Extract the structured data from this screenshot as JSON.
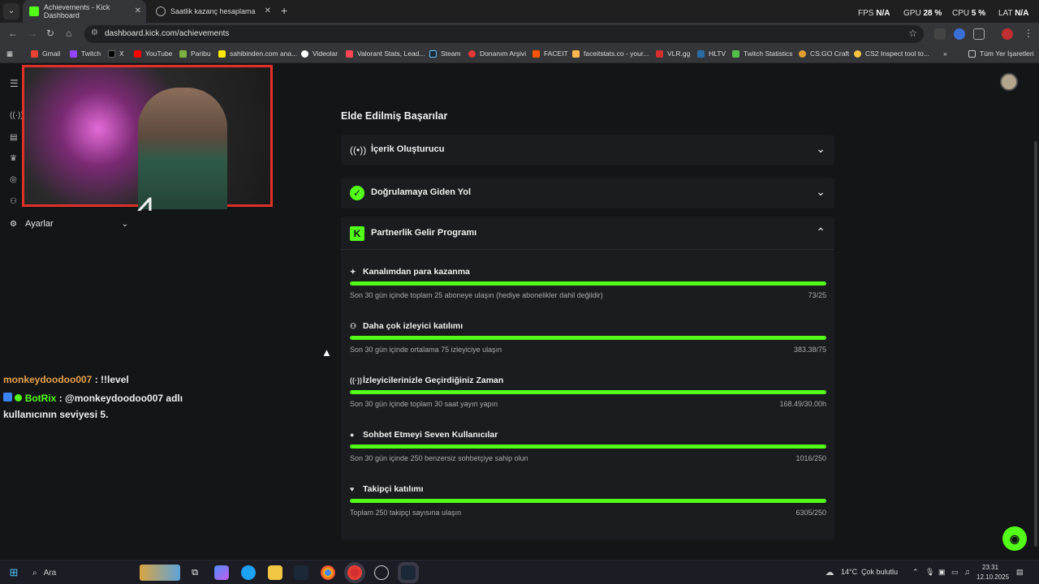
{
  "browser": {
    "tabs": [
      {
        "title": "Achievements - Kick Dashboard",
        "active": true
      },
      {
        "title": "Saatlik kazanç hesaplama",
        "active": false
      }
    ],
    "hw": {
      "fps_label": "FPS",
      "fps": "N/A",
      "gpu_label": "GPU",
      "gpu": "28 %",
      "cpu_label": "CPU",
      "cpu": "5 %",
      "lat_label": "LAT",
      "lat": "N/A"
    },
    "url": "dashboard.kick.com/achievements",
    "bookmarks": [
      "Gmail",
      "Twitch",
      "X",
      "YouTube",
      "Paribu",
      "sahibinden.com ana...",
      "Videolar",
      "Valorant Stats, Lead...",
      "Steam",
      "Donanım Arşivi",
      "FACEIT",
      "faceitstats.co - your...",
      "VLR.gg",
      "HLTV",
      "Twitch Statistics",
      "CS:GO Craft",
      "CS2 Inspect tool to..."
    ],
    "all_bookmarks": "Tüm Yer İşaretleri"
  },
  "sidebar": {
    "settings_label": "Ayarlar"
  },
  "chat": [
    {
      "user": "monkeydoodoo007",
      "text": " : !!level"
    },
    {
      "user": "BotRix",
      "text": " : @monkeydoodoo007 adlı",
      "text2": "kullanıcının seviyesi 5."
    }
  ],
  "main": {
    "title": "Elde Edilmiş Başarılar",
    "sections": [
      {
        "label": "İçerik Oluşturucu",
        "expanded": false
      },
      {
        "label": "Doğrulamaya Giden Yol",
        "expanded": false
      },
      {
        "label": "Partnerlik Gelir Programı",
        "expanded": true
      }
    ],
    "achievements": [
      {
        "title": "Kanalımdan para kazanma",
        "desc": "Son 30 gün içinde toplam 25 aboneye ulaşın (hediye abonelikler dahil değildir)",
        "value": "73/25",
        "progress": 1.0
      },
      {
        "title": "Daha çok izleyici katılımı",
        "desc": "Son 30 gün içinde ortalama 75 izleyiciye ulaşın",
        "value": "383.38/75",
        "progress": 1.0
      },
      {
        "title": "İzleyicilerinizle Geçirdiğiniz Zaman",
        "desc": "Son 30 gün içinde toplam 30 saat yayın yapın",
        "value": "168.49/30.00h",
        "progress": 1.0
      },
      {
        "title": "Sohbet Etmeyi Seven Kullanıcılar",
        "desc": "Son 30 gün içinde 250 benzersiz sohbetçiye sahip olun",
        "value": "1016/250",
        "progress": 1.0
      },
      {
        "title": "Takipçi katılımı",
        "desc": "Toplam 250 takipçi sayısına ulaşın",
        "value": "6305/250",
        "progress": 1.0
      }
    ]
  },
  "taskbar": {
    "search": "Ara",
    "weather": "14°C",
    "weather_desc": "Çok bulutlu",
    "time": "23:31",
    "date": "12.10.2025"
  },
  "colors": {
    "accent": "#53fc18",
    "background": "#141517",
    "card": "#1b1c1f"
  }
}
